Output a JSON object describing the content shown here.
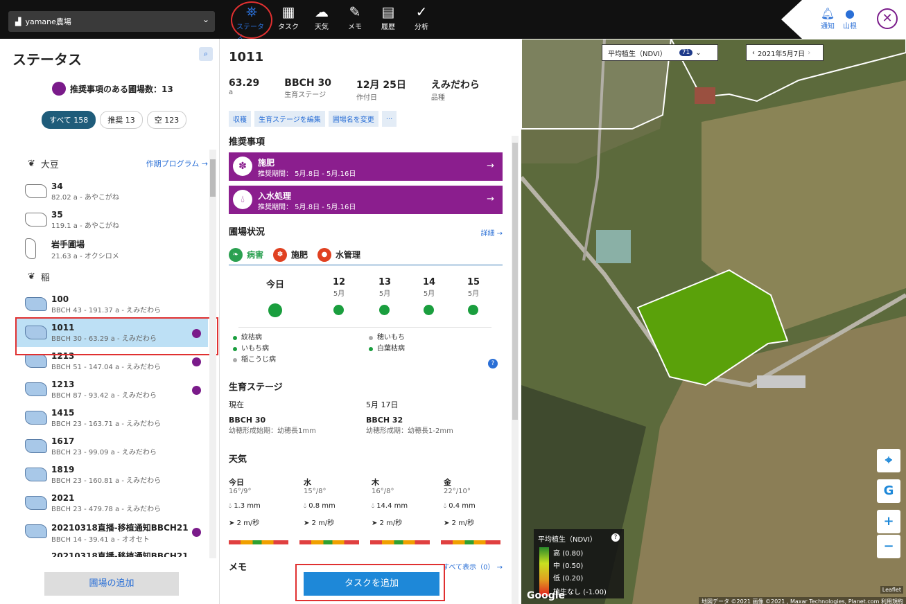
{
  "topbar": {
    "farm": "yamane農場",
    "nav": [
      {
        "label": "ステータス",
        "icon": "status-icon"
      },
      {
        "label": "タスク",
        "icon": "task-icon"
      },
      {
        "label": "天気",
        "icon": "weather-icon"
      },
      {
        "label": "メモ",
        "icon": "memo-icon"
      },
      {
        "label": "履歴",
        "icon": "history-icon"
      },
      {
        "label": "分析",
        "icon": "analysis-icon"
      }
    ],
    "notify": "通知",
    "user": "山根"
  },
  "left": {
    "title": "ステータス",
    "rec_count": "推奨事項のある圃場数：13",
    "filters": [
      "すべて 158",
      "推奨 13",
      "空 123"
    ],
    "cat_soy": "大豆",
    "prog_link": "作期プログラム →",
    "cat_rice": "稲",
    "fields": [
      {
        "name": "34",
        "sub": "82.02 a - あやこがね",
        "dot": false
      },
      {
        "name": "35",
        "sub": "119.1 a - あやこがね",
        "dot": false
      },
      {
        "name": "岩手圃場",
        "sub": "21.63 a - オクシロメ",
        "dot": false
      },
      {
        "name": "100",
        "sub": "BBCH 43 - 191.37 a - えみだわら",
        "dot": false
      },
      {
        "name": "1011",
        "sub": "BBCH 30 - 63.29 a - えみだわら",
        "dot": true
      },
      {
        "name": "1213",
        "sub": "BBCH 51 - 147.04 a - えみだわら",
        "dot": true
      },
      {
        "name": "1213",
        "sub": "BBCH 87 - 93.42 a - えみだわら",
        "dot": true
      },
      {
        "name": "1415",
        "sub": "BBCH 23 - 163.71 a - えみだわら",
        "dot": false
      },
      {
        "name": "1617",
        "sub": "BBCH 23 - 99.09 a - えみだわら",
        "dot": false
      },
      {
        "name": "1819",
        "sub": "BBCH 23 - 160.81 a - えみだわら",
        "dot": false
      },
      {
        "name": "2021",
        "sub": "BBCH 23 - 479.78 a - えみだわら",
        "dot": false
      },
      {
        "name": "20210318直播-移植通知BBCH21",
        "sub": "BBCH 14 - 39.41 a - オオセト",
        "dot": true
      },
      {
        "name": "20210318直播-移植通知BBCH21",
        "sub": "",
        "dot": false
      }
    ],
    "add_field": "圃場の追加"
  },
  "mid": {
    "field_id": "1011",
    "stats": [
      {
        "v": "63.29",
        "l": "a"
      },
      {
        "v": "BBCH 30",
        "l": "生育ステージ"
      },
      {
        "v": "12月 25日",
        "l": "作付日"
      },
      {
        "v": "えみだわら",
        "l": "品種"
      }
    ],
    "actions": [
      "収穫",
      "生育ステージを編集",
      "圃場名を変更",
      "..."
    ],
    "rec_title": "推奨事項",
    "recs": [
      {
        "title": "施肥",
        "period": "推奨期間： 5月.8日 - 5月.16日"
      },
      {
        "title": "入水処理",
        "period": "推奨期間： 5月.8日 - 5月.16日"
      }
    ],
    "status_title": "圃場状況",
    "detail": "詳細 →",
    "tabs": [
      "病害",
      "施肥",
      "水管理"
    ],
    "days": [
      {
        "d": "今日",
        "m": ""
      },
      {
        "d": "12",
        "m": "5月"
      },
      {
        "d": "13",
        "m": "5月"
      },
      {
        "d": "14",
        "m": "5月"
      },
      {
        "d": "15",
        "m": "5月"
      }
    ],
    "diseases_left": [
      "紋枯病",
      "いもち病",
      "稲こうじ病"
    ],
    "diseases_right": [
      "穂いもち",
      "白葉枯病"
    ],
    "growth_title": "生育ステージ",
    "growth": [
      {
        "h": "現在",
        "a": "BBCH 30",
        "b": "幼穂形成始期：幼穂長1mm"
      },
      {
        "h": "5月 17日",
        "a": "BBCH 32",
        "b": "幼穂形成期：幼穂長1-2mm"
      }
    ],
    "weather_title": "天気",
    "weather": [
      {
        "d": "今日",
        "t": "16°/9°",
        "r": "1.3 mm",
        "w": "2 m/秒"
      },
      {
        "d": "水",
        "t": "15°/8°",
        "r": "0.8 mm",
        "w": "2 m/秒"
      },
      {
        "d": "木",
        "t": "16°/8°",
        "r": "14.4 mm",
        "w": "2 m/秒"
      },
      {
        "d": "金",
        "t": "22°/10°",
        "r": "0.4 mm",
        "w": "2 m/秒"
      }
    ],
    "memo_title": "メモ",
    "show_all": "すべて表示（0） →",
    "add_task": "タスクを追加"
  },
  "map": {
    "layer": "平均植生（NDVI）",
    "layer_badge": "71",
    "date": "2021年5月7日",
    "legend_title": "平均植生（NDVI）",
    "legend": [
      "高 (0.80)",
      "中 (0.50)",
      "低 (0.20)",
      "植生なし (-1.00)"
    ],
    "google": "Google",
    "leaflet": "Leaflet",
    "credit": "地図データ ©2021 画像 ©2021 , Maxar Technologies, Planet.com   利用規約"
  }
}
